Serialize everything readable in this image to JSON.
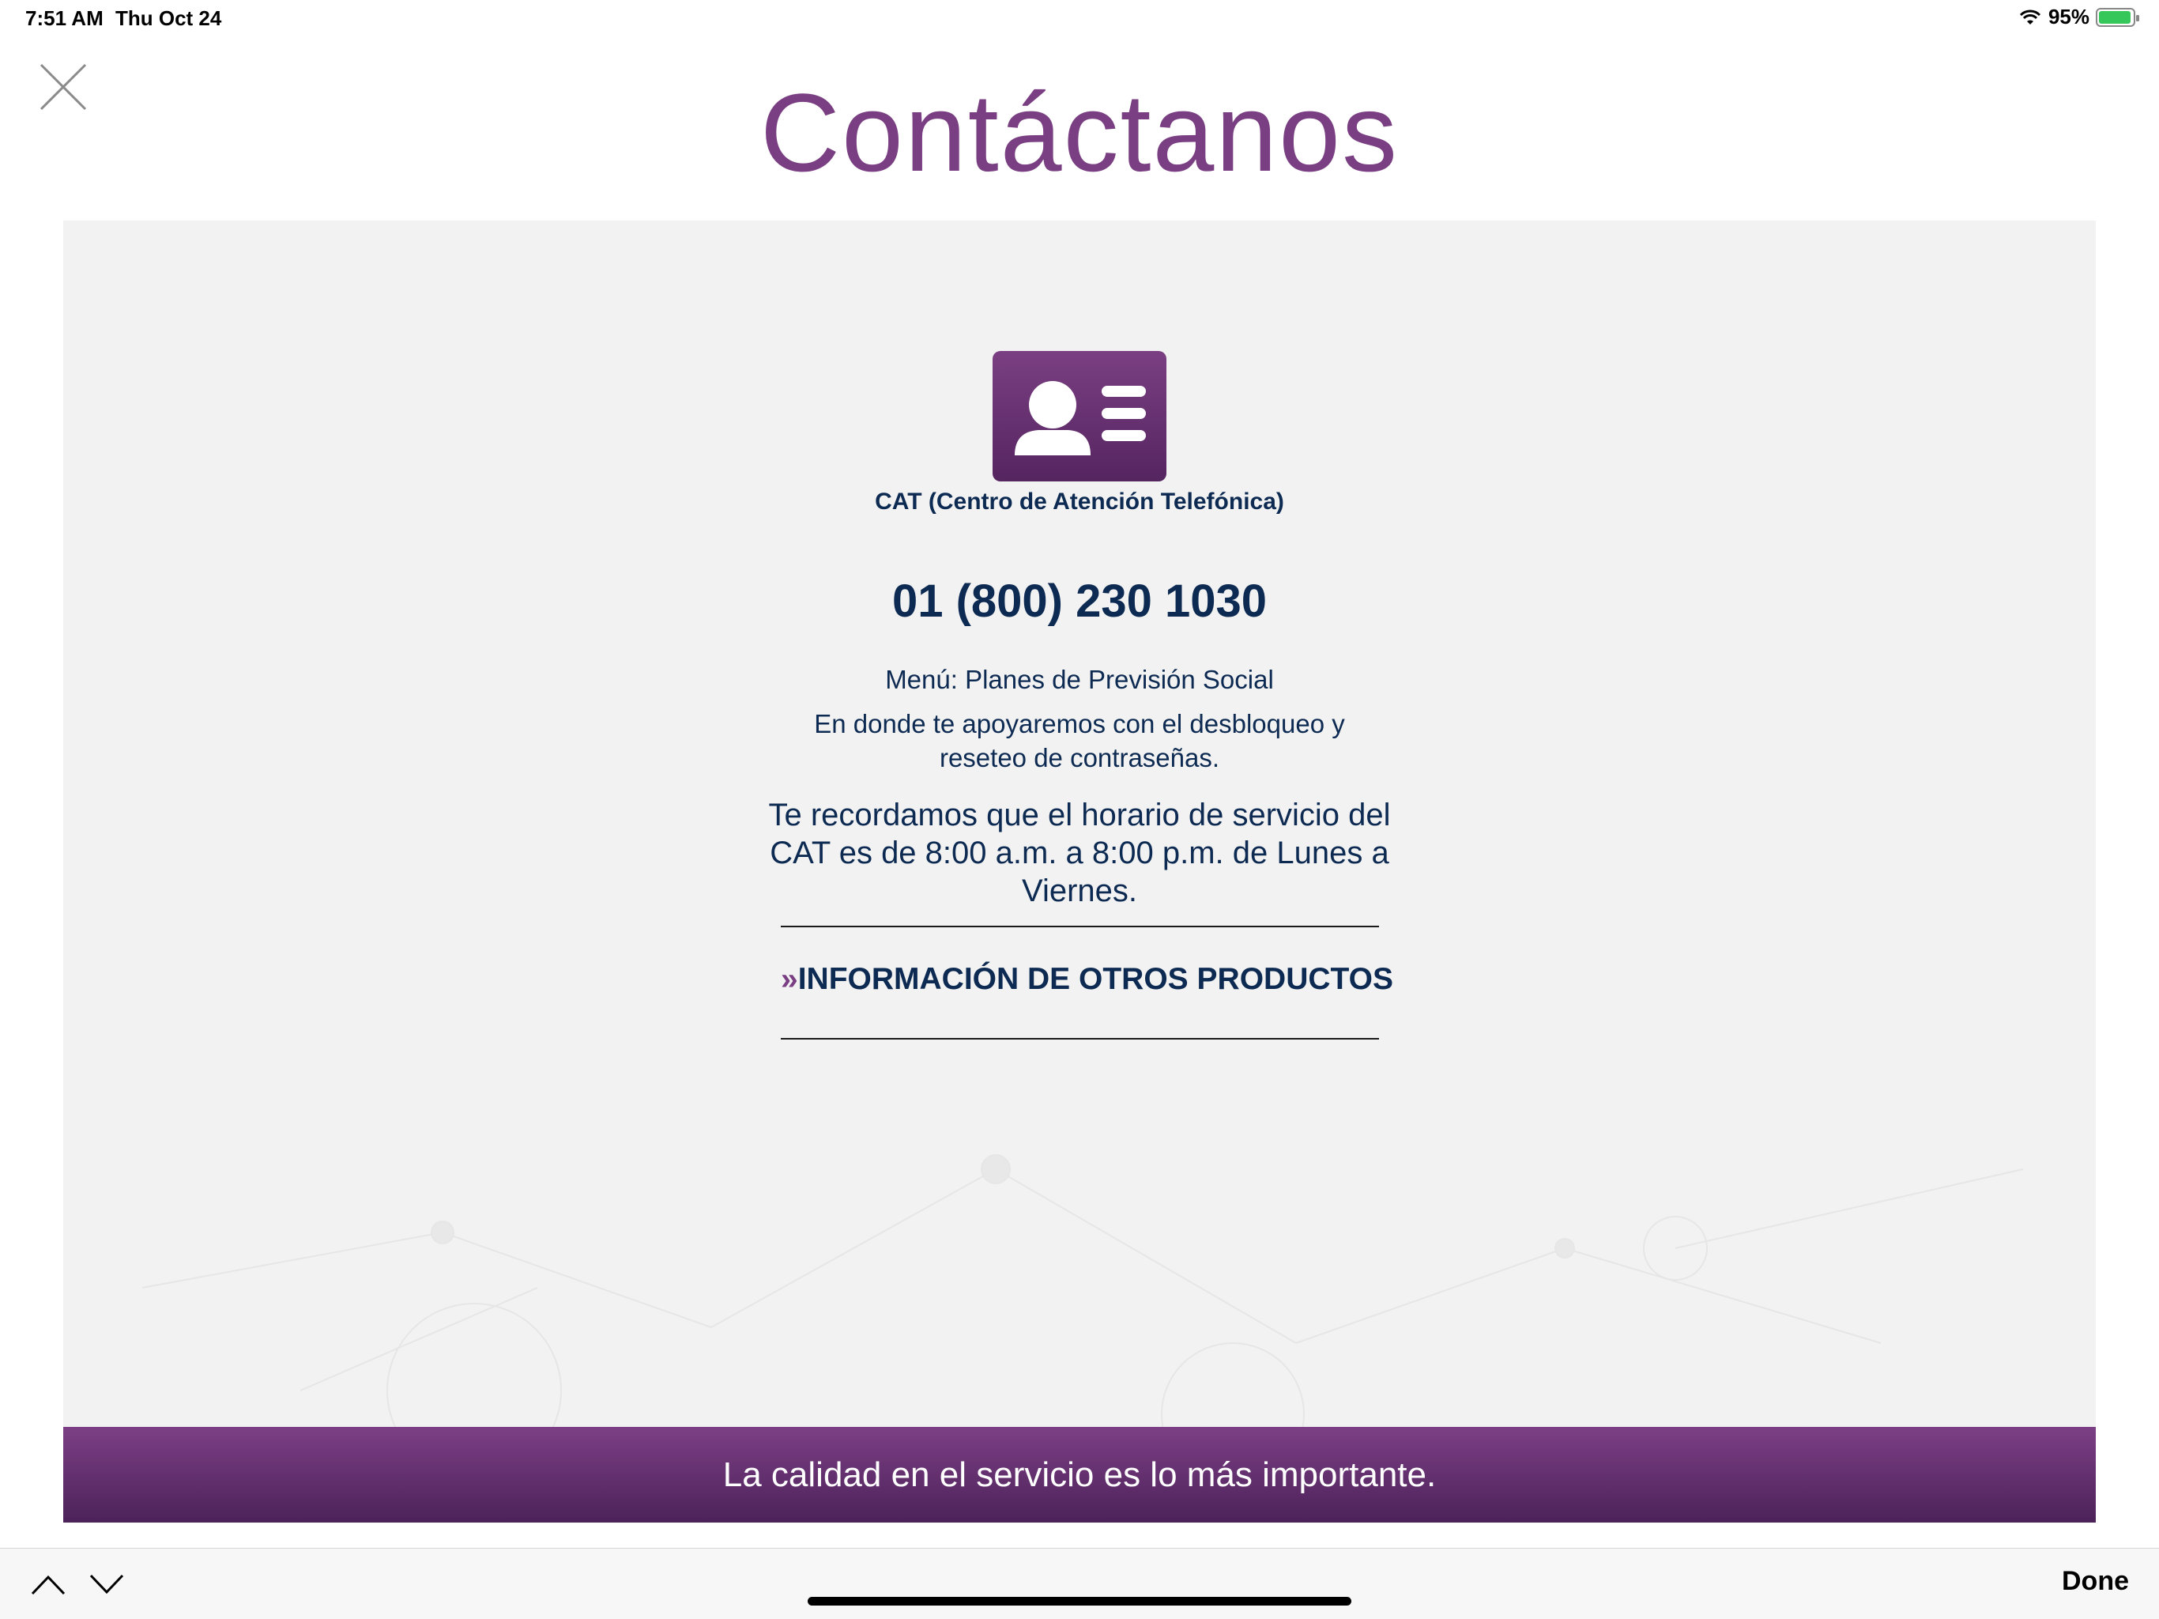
{
  "status_bar": {
    "time": "7:51 AM",
    "date": "Thu Oct 24",
    "battery_percent_text": "95%",
    "battery_level": 0.95,
    "wifi_icon": "wifi-icon"
  },
  "header": {
    "title": "Contáctanos",
    "close_icon": "close-icon"
  },
  "contact": {
    "icon": "contact-card-icon",
    "cat_label": "CAT (Centro de Atención Telefónica)",
    "phone": "01 (800) 230 1030",
    "menu_line": "Menú: Planes de Previsión Social",
    "support_line_1": "En donde te apoyaremos con el desbloqueo y",
    "support_line_2": "reseteo de contraseñas.",
    "hours_line_1": "Te recordamos que el horario de servicio del",
    "hours_line_2": "CAT es de 8:00 a.m. a 8:00 p.m. de Lunes a",
    "hours_line_3": "Viernes.",
    "other_products_arrow": "»",
    "other_products_label": "INFORMACIÓN DE OTROS PRODUCTOS"
  },
  "banner": {
    "text": "La calidad en el servicio es lo más importante."
  },
  "toolbar": {
    "up_icon": "chevron-up-icon",
    "down_icon": "chevron-down-icon",
    "done_label": "Done"
  },
  "colors": {
    "brand_purple": "#7a3f82",
    "text_navy": "#0d2a52",
    "card_bg": "#f2f2f2"
  }
}
